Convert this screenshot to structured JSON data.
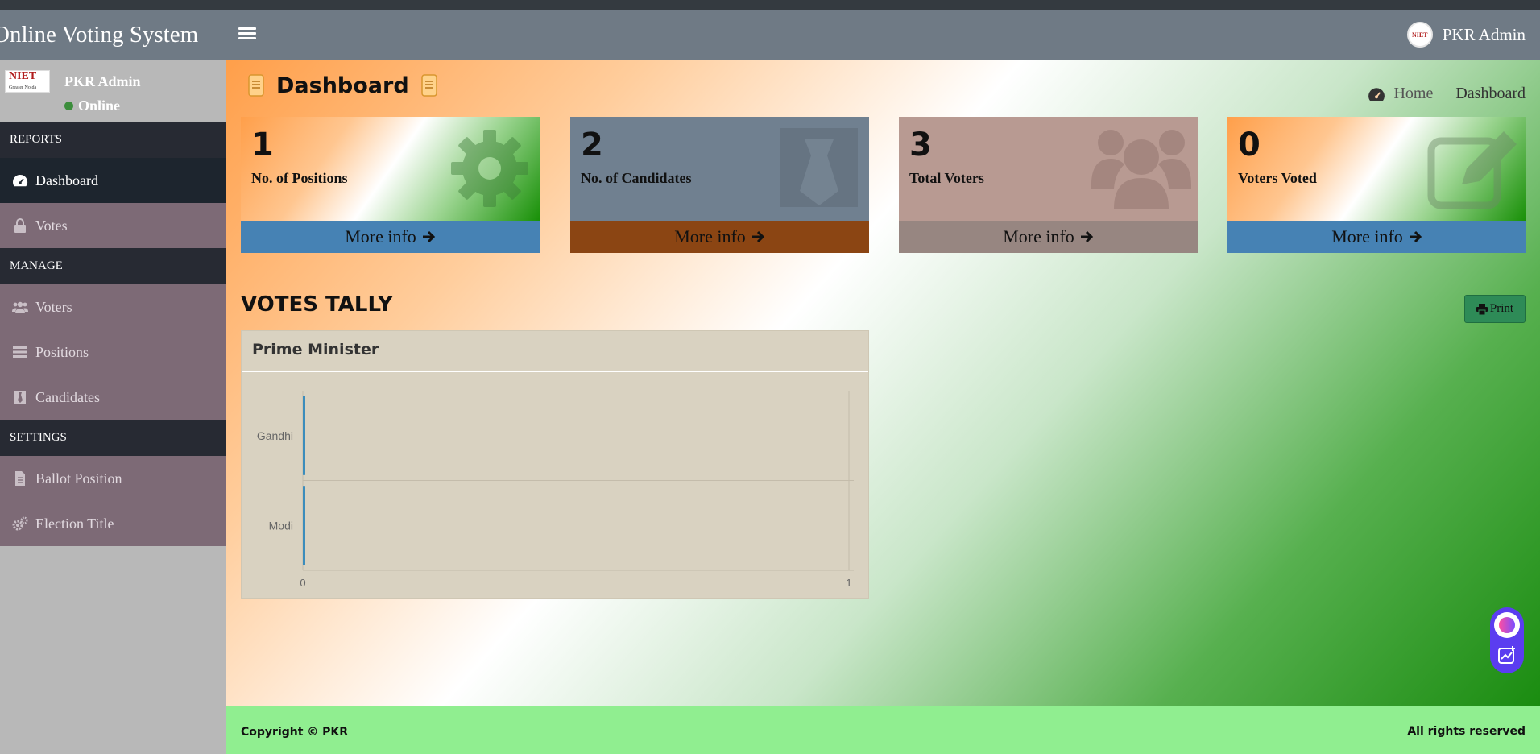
{
  "header": {
    "brand": "Online Voting System",
    "user_name": "PKR Admin",
    "user_img_text": "NIET"
  },
  "sidebar": {
    "logo_text": "NIET",
    "logo_sub": "Greater Noida",
    "user_name": "PKR Admin",
    "status": "Online",
    "sections": [
      "REPORTS",
      "MANAGE",
      "SETTINGS"
    ],
    "items": [
      {
        "label": "Dashboard",
        "icon": "dashboard-icon"
      },
      {
        "label": "Votes",
        "icon": "lock-icon"
      },
      {
        "label": "Voters",
        "icon": "users-icon"
      },
      {
        "label": "Positions",
        "icon": "tasks-icon"
      },
      {
        "label": "Candidates",
        "icon": "black-tie-icon"
      },
      {
        "label": "Ballot Position",
        "icon": "file-text-icon"
      },
      {
        "label": "Election Title",
        "icon": "cogs-icon"
      }
    ]
  },
  "page": {
    "title": "Dashboard",
    "breadcrumb_home": "Home",
    "breadcrumb_current": "Dashboard"
  },
  "stats": [
    {
      "value": "1",
      "label": "No. of Positions",
      "more": "More info",
      "icon": "gear-icon",
      "bg": "#ff9f4a",
      "footer_bg": "#4682b4"
    },
    {
      "value": "2",
      "label": "No. of Candidates",
      "more": "More info",
      "icon": "tie-icon",
      "bg": "#708090",
      "footer_bg": "#8b4513"
    },
    {
      "value": "3",
      "label": "Total Voters",
      "more": "More info",
      "icon": "users-icon",
      "bg": "#bc9a92",
      "footer_bg": "#978681"
    },
    {
      "value": "0",
      "label": "Voters Voted",
      "more": "More info",
      "icon": "edit-icon",
      "bg": "#ff9f4a",
      "footer_bg": "#4682b4"
    }
  ],
  "tally": {
    "title": "VOTES TALLY",
    "print_label": "Print"
  },
  "chart_data": {
    "type": "bar",
    "orientation": "horizontal",
    "title": "Prime Minister",
    "categories": [
      "Gandhi",
      "Modi"
    ],
    "values": [
      0,
      0
    ],
    "xlim": [
      0,
      1
    ],
    "ticks": [
      "0",
      "1"
    ],
    "bar_color": "#3c8dbc",
    "grid": true
  },
  "footer": {
    "copyright": "Copyright © PKR",
    "rights": "All rights reserved"
  }
}
